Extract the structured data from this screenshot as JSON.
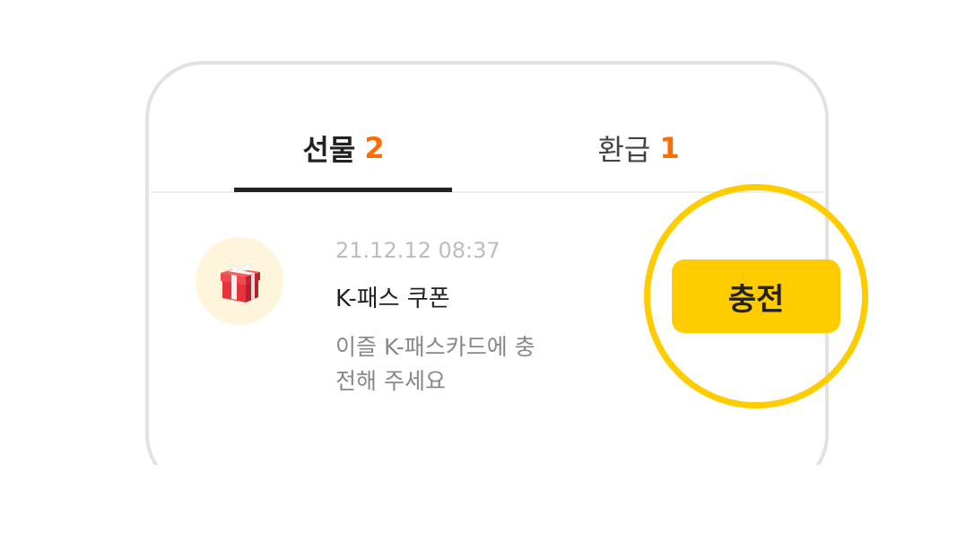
{
  "tabs": {
    "gift": {
      "label": "선물",
      "count": "2",
      "selected": true
    },
    "refund": {
      "label": "환급",
      "count": "1",
      "selected": false
    }
  },
  "item": {
    "timestamp": "21.12.12 08:37",
    "title": "K-패스 쿠폰",
    "description": "이즐 K-패스카드에 충전해 주세요",
    "icon": "gift-box-icon"
  },
  "charge_button": {
    "label": "충전"
  },
  "colors": {
    "accent_orange": "#ff6b00",
    "button_yellow": "#ffcc00",
    "ring_yellow": "#ffcc00",
    "avatar_bg": "#fff4dc"
  }
}
